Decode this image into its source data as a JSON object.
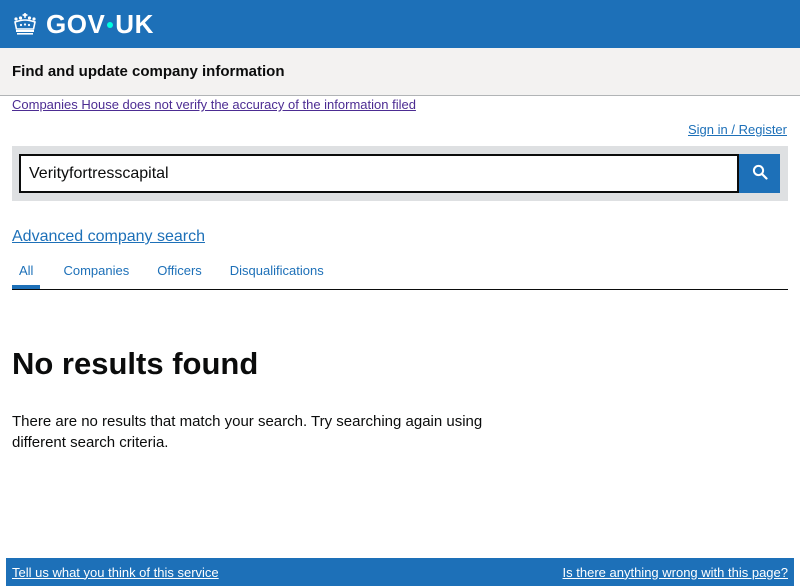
{
  "header": {
    "logo_text_left": "GOV",
    "logo_text_right": "UK",
    "logo_icon": "crown-icon",
    "brand_color": "#1d70b8"
  },
  "service": {
    "name": "Find and update company information"
  },
  "disclaimer": {
    "text": "Companies House does not verify the accuracy of the information filed"
  },
  "account": {
    "signin_label": "Sign in / Register"
  },
  "search": {
    "value": "Verityfortresscapital",
    "button_icon": "search-icon"
  },
  "advanced": {
    "label": "Advanced company search"
  },
  "tabs": [
    {
      "label": "All",
      "active": true
    },
    {
      "label": "Companies",
      "active": false
    },
    {
      "label": "Officers",
      "active": false
    },
    {
      "label": "Disqualifications",
      "active": false
    }
  ],
  "results": {
    "heading": "No results found",
    "message": "There are no results that match your search. Try searching again using different search criteria."
  },
  "footer": {
    "feedback_link": "Tell us what you think of this service",
    "report_link": "Is there anything wrong with this page?"
  }
}
